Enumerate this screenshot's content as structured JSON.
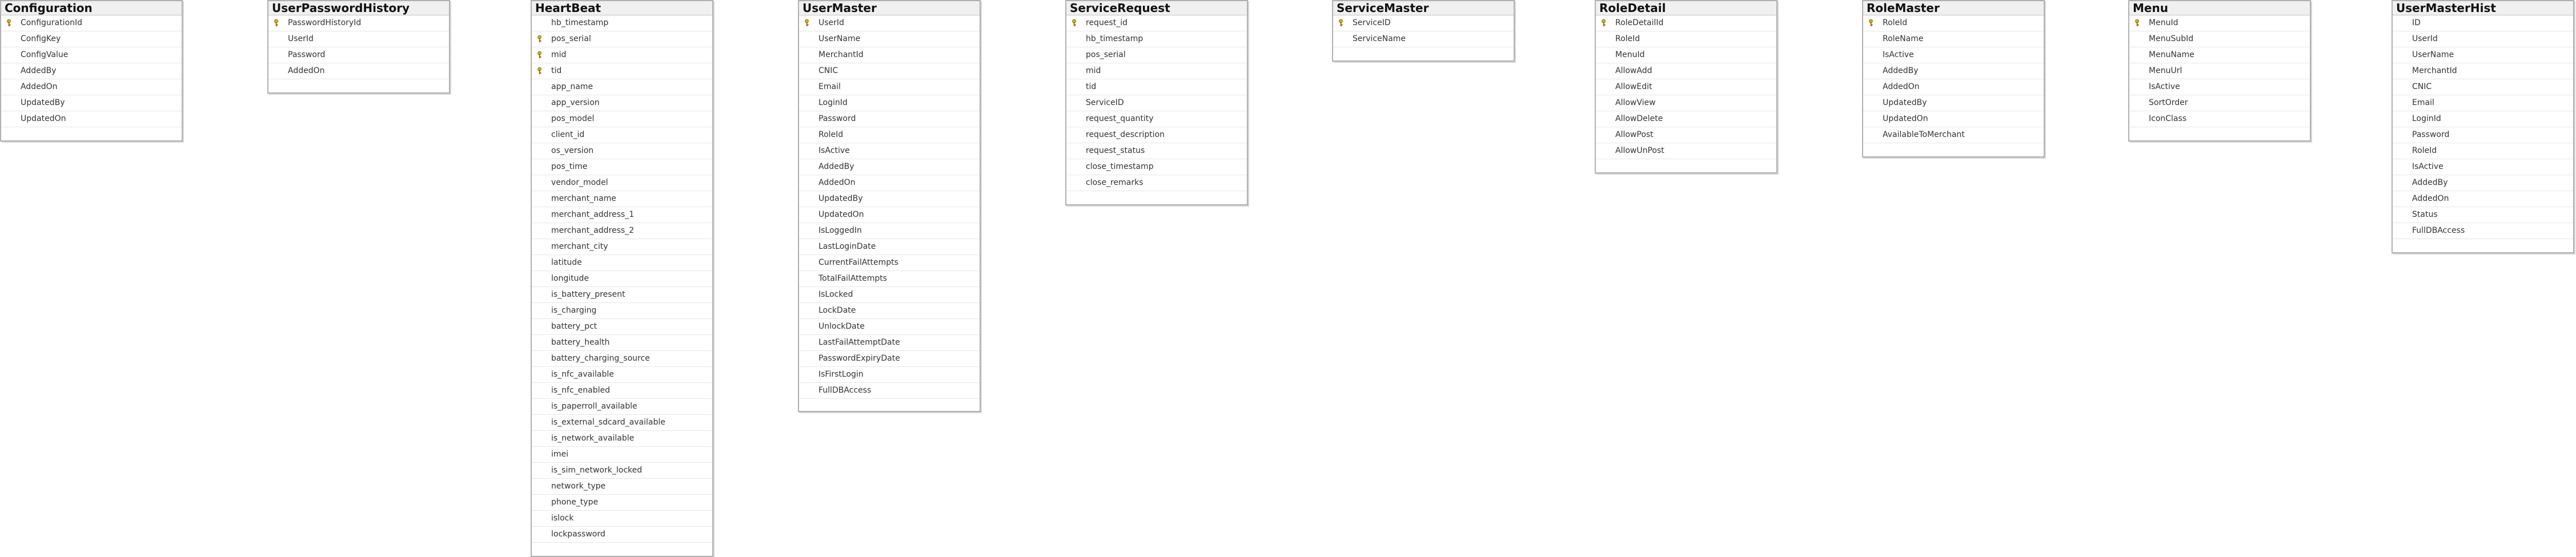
{
  "tables": [
    {
      "name": "Configuration",
      "columns": [
        {
          "label": "ConfigurationId",
          "pk": true
        },
        {
          "label": "ConfigKey",
          "pk": false
        },
        {
          "label": "ConfigValue",
          "pk": false
        },
        {
          "label": "AddedBy",
          "pk": false
        },
        {
          "label": "AddedOn",
          "pk": false
        },
        {
          "label": "UpdatedBy",
          "pk": false
        },
        {
          "label": "UpdatedOn",
          "pk": false
        }
      ]
    },
    {
      "name": "UserPasswordHistory",
      "columns": [
        {
          "label": "PasswordHistoryId",
          "pk": true
        },
        {
          "label": "UserId",
          "pk": false
        },
        {
          "label": "Password",
          "pk": false
        },
        {
          "label": "AddedOn",
          "pk": false
        }
      ]
    },
    {
      "name": "HeartBeat",
      "columns": [
        {
          "label": "hb_timestamp",
          "pk": false
        },
        {
          "label": "pos_serial",
          "pk": true
        },
        {
          "label": "mid",
          "pk": true
        },
        {
          "label": "tid",
          "pk": true
        },
        {
          "label": "app_name",
          "pk": false
        },
        {
          "label": "app_version",
          "pk": false
        },
        {
          "label": "pos_model",
          "pk": false
        },
        {
          "label": "client_id",
          "pk": false
        },
        {
          "label": "os_version",
          "pk": false
        },
        {
          "label": "pos_time",
          "pk": false
        },
        {
          "label": "vendor_model",
          "pk": false
        },
        {
          "label": "merchant_name",
          "pk": false
        },
        {
          "label": "merchant_address_1",
          "pk": false
        },
        {
          "label": "merchant_address_2",
          "pk": false
        },
        {
          "label": "merchant_city",
          "pk": false
        },
        {
          "label": "latitude",
          "pk": false
        },
        {
          "label": "longitude",
          "pk": false
        },
        {
          "label": "is_battery_present",
          "pk": false
        },
        {
          "label": "is_charging",
          "pk": false
        },
        {
          "label": "battery_pct",
          "pk": false
        },
        {
          "label": "battery_health",
          "pk": false
        },
        {
          "label": "battery_charging_source",
          "pk": false
        },
        {
          "label": "is_nfc_available",
          "pk": false
        },
        {
          "label": "is_nfc_enabled",
          "pk": false
        },
        {
          "label": "is_paperroll_available",
          "pk": false
        },
        {
          "label": "is_external_sdcard_available",
          "pk": false
        },
        {
          "label": "is_network_available",
          "pk": false
        },
        {
          "label": "imei",
          "pk": false
        },
        {
          "label": "is_sim_network_locked",
          "pk": false
        },
        {
          "label": "network_type",
          "pk": false
        },
        {
          "label": "phone_type",
          "pk": false
        },
        {
          "label": "islock",
          "pk": false
        },
        {
          "label": "lockpassword",
          "pk": false
        }
      ]
    },
    {
      "name": "UserMaster",
      "columns": [
        {
          "label": "UserId",
          "pk": true
        },
        {
          "label": "UserName",
          "pk": false
        },
        {
          "label": "MerchantId",
          "pk": false
        },
        {
          "label": "CNIC",
          "pk": false
        },
        {
          "label": "Email",
          "pk": false
        },
        {
          "label": "LoginId",
          "pk": false
        },
        {
          "label": "Password",
          "pk": false
        },
        {
          "label": "RoleId",
          "pk": false
        },
        {
          "label": "IsActive",
          "pk": false
        },
        {
          "label": "AddedBy",
          "pk": false
        },
        {
          "label": "AddedOn",
          "pk": false
        },
        {
          "label": "UpdatedBy",
          "pk": false
        },
        {
          "label": "UpdatedOn",
          "pk": false
        },
        {
          "label": "IsLoggedIn",
          "pk": false
        },
        {
          "label": "LastLoginDate",
          "pk": false
        },
        {
          "label": "CurrentFailAttempts",
          "pk": false
        },
        {
          "label": "TotalFailAttempts",
          "pk": false
        },
        {
          "label": "IsLocked",
          "pk": false
        },
        {
          "label": "LockDate",
          "pk": false
        },
        {
          "label": "UnlockDate",
          "pk": false
        },
        {
          "label": "LastFailAttemptDate",
          "pk": false
        },
        {
          "label": "PasswordExpiryDate",
          "pk": false
        },
        {
          "label": "IsFirstLogin",
          "pk": false
        },
        {
          "label": "FullDBAccess",
          "pk": false
        }
      ]
    },
    {
      "name": "ServiceRequest",
      "columns": [
        {
          "label": "request_id",
          "pk": true
        },
        {
          "label": "hb_timestamp",
          "pk": false
        },
        {
          "label": "pos_serial",
          "pk": false
        },
        {
          "label": "mid",
          "pk": false
        },
        {
          "label": "tid",
          "pk": false
        },
        {
          "label": "ServiceID",
          "pk": false
        },
        {
          "label": "request_quantity",
          "pk": false
        },
        {
          "label": "request_description",
          "pk": false
        },
        {
          "label": "request_status",
          "pk": false
        },
        {
          "label": "close_timestamp",
          "pk": false
        },
        {
          "label": "close_remarks",
          "pk": false
        }
      ]
    },
    {
      "name": "ServiceMaster",
      "columns": [
        {
          "label": "ServiceID",
          "pk": true
        },
        {
          "label": "ServiceName",
          "pk": false
        }
      ]
    },
    {
      "name": "RoleDetail",
      "columns": [
        {
          "label": "RoleDetailId",
          "pk": true
        },
        {
          "label": "RoleId",
          "pk": false
        },
        {
          "label": "MenuId",
          "pk": false
        },
        {
          "label": "AllowAdd",
          "pk": false
        },
        {
          "label": "AllowEdit",
          "pk": false
        },
        {
          "label": "AllowView",
          "pk": false
        },
        {
          "label": "AllowDelete",
          "pk": false
        },
        {
          "label": "AllowPost",
          "pk": false
        },
        {
          "label": "AllowUnPost",
          "pk": false
        }
      ]
    },
    {
      "name": "RoleMaster",
      "columns": [
        {
          "label": "RoleId",
          "pk": true
        },
        {
          "label": "RoleName",
          "pk": false
        },
        {
          "label": "IsActive",
          "pk": false
        },
        {
          "label": "AddedBy",
          "pk": false
        },
        {
          "label": "AddedOn",
          "pk": false
        },
        {
          "label": "UpdatedBy",
          "pk": false
        },
        {
          "label": "UpdatedOn",
          "pk": false
        },
        {
          "label": "AvailableToMerchant",
          "pk": false
        }
      ]
    },
    {
      "name": "Menu",
      "columns": [
        {
          "label": "MenuId",
          "pk": true
        },
        {
          "label": "MenuSubId",
          "pk": false
        },
        {
          "label": "MenuName",
          "pk": false
        },
        {
          "label": "MenuUrl",
          "pk": false
        },
        {
          "label": "IsActive",
          "pk": false
        },
        {
          "label": "SortOrder",
          "pk": false
        },
        {
          "label": "IconClass",
          "pk": false
        }
      ]
    },
    {
      "name": "UserMasterHist",
      "columns": [
        {
          "label": "ID",
          "pk": false
        },
        {
          "label": "UserId",
          "pk": false
        },
        {
          "label": "UserName",
          "pk": false
        },
        {
          "label": "MerchantId",
          "pk": false
        },
        {
          "label": "CNIC",
          "pk": false
        },
        {
          "label": "Email",
          "pk": false
        },
        {
          "label": "LoginId",
          "pk": false
        },
        {
          "label": "Password",
          "pk": false
        },
        {
          "label": "RoleId",
          "pk": false
        },
        {
          "label": "IsActive",
          "pk": false
        },
        {
          "label": "AddedBy",
          "pk": false
        },
        {
          "label": "AddedOn",
          "pk": false
        },
        {
          "label": "Status",
          "pk": false
        },
        {
          "label": "FullDBAccess",
          "pk": false
        }
      ]
    }
  ]
}
